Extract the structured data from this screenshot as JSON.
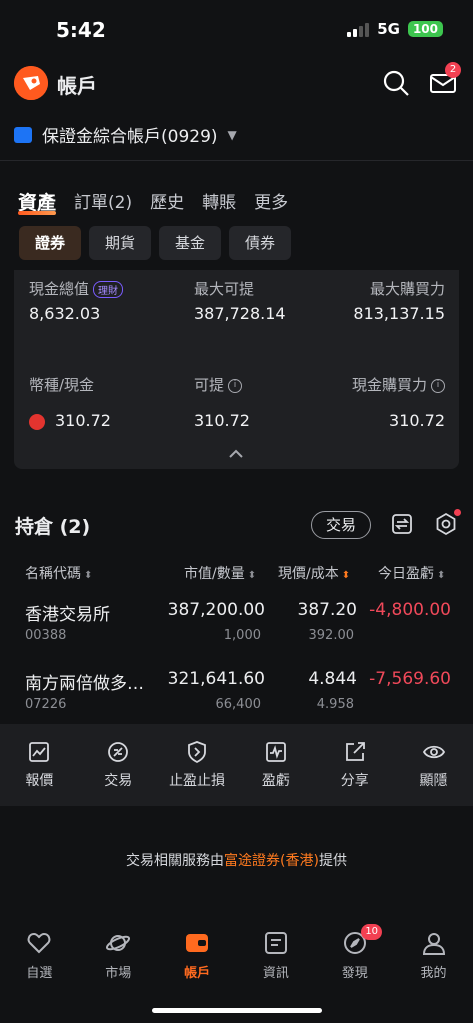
{
  "status": {
    "time": "5:42",
    "network": "5G",
    "battery": "100"
  },
  "header": {
    "title": "帳戶",
    "mail_badge": "2"
  },
  "account": {
    "name": "保證金綜合帳戶(0929)"
  },
  "main_tabs": [
    "資產",
    "訂單(2)",
    "歷史",
    "轉賬",
    "更多"
  ],
  "sub_tabs": [
    "證券",
    "期貨",
    "基金",
    "債券"
  ],
  "summary": {
    "total_cash_label": "現金總值",
    "total_cash_tag": "理財",
    "total_cash_value": "8,632.03",
    "max_withdraw_label": "最大可提",
    "max_withdraw_value": "387,728.14",
    "max_buying_label": "最大購買力",
    "max_buying_value": "813,137.15",
    "currency_label": "幣種/現金",
    "withdrawable_label": "可提",
    "cash_buying_label": "現金購買力",
    "hkd_cash": "310.72",
    "hkd_withdrawable": "310.72",
    "hkd_buying": "310.72"
  },
  "positions": {
    "title": "持倉 (2)",
    "trade_label": "交易",
    "columns": [
      "名稱代碼",
      "市值/數量",
      "現價/成本",
      "今日盈虧"
    ],
    "rows": [
      {
        "name": "香港交易所",
        "code": "00388",
        "market_value": "387,200.00",
        "quantity": "1,000",
        "price": "387.20",
        "cost": "392.00",
        "pnl": "-4,800.00"
      },
      {
        "name": "南方兩倍做多…",
        "code": "07226",
        "market_value": "321,641.60",
        "quantity": "66,400",
        "price": "4.844",
        "cost": "4.958",
        "pnl": "-7,569.60"
      }
    ]
  },
  "actions": [
    "報價",
    "交易",
    "止盈止損",
    "盈虧",
    "分享",
    "顯隱"
  ],
  "footer": {
    "prefix": "交易相關服務由",
    "broker": "富途證券(香港)",
    "suffix": "提供"
  },
  "nav": {
    "items": [
      "自選",
      "市場",
      "帳戶",
      "資訊",
      "發現",
      "我的"
    ],
    "discover_badge": "10"
  },
  "colors": {
    "accent": "#FF6A1F",
    "loss": "#F0495A",
    "background": "#111214"
  }
}
